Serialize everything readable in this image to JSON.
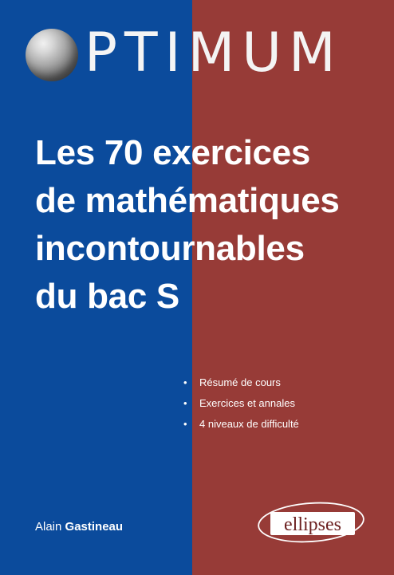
{
  "series": {
    "name": "PTIMUM",
    "sphere_icon": "sphere-icon"
  },
  "book": {
    "title_lines": [
      "Les 70 exercices",
      "de mathématiques",
      "incontournables",
      "du bac S"
    ]
  },
  "features": [
    "Résumé de cours",
    "Exercices et annales",
    "4 niveaux de difficulté"
  ],
  "author": {
    "first": "Alain",
    "last": "Gastineau"
  },
  "publisher": {
    "name": "ellipses"
  },
  "colors": {
    "left_panel": "#0b4b9c",
    "right_panel": "#973b37",
    "text": "#ffffff"
  }
}
